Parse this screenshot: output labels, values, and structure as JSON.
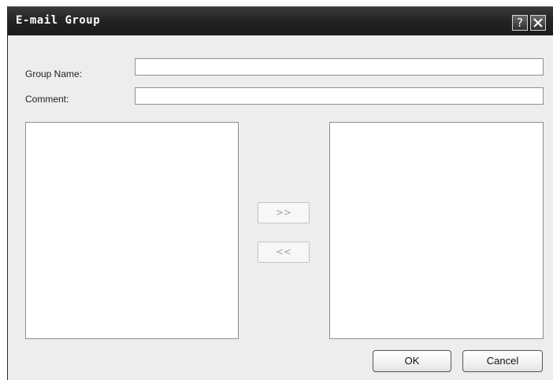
{
  "window": {
    "title": "E-mail Group",
    "help_glyph": "?",
    "help_icon": "question-mark-icon",
    "close_icon": "close-x-icon"
  },
  "form": {
    "group_name_label": "Group Name:",
    "group_name_value": "",
    "comment_label": "Comment:",
    "comment_value": ""
  },
  "lists": {
    "available_items": [],
    "selected_items": []
  },
  "move_buttons": {
    "add_label": ">>",
    "remove_label": "<<",
    "enabled": false
  },
  "actions": {
    "ok_label": "OK",
    "cancel_label": "Cancel"
  },
  "colors": {
    "dialog_background": "#efecef",
    "titlebar": "#242424",
    "title_text": "#ffffff",
    "disabled_text": "#a0a0a0"
  }
}
